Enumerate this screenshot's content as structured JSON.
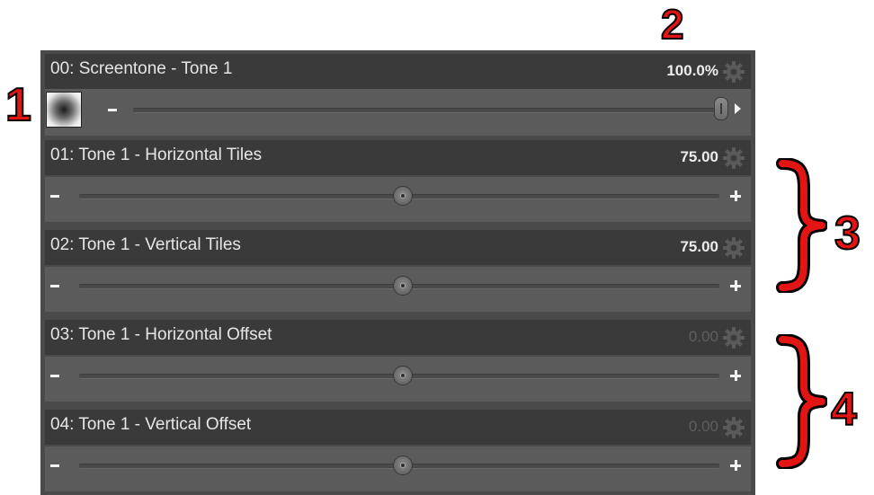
{
  "rows": [
    {
      "title": "00: Screentone - Tone 1",
      "value": "100.0%",
      "value_dim": false,
      "minus": "-",
      "plus": "",
      "slider_fraction": 1.0,
      "has_thumbnail": true
    },
    {
      "title": "01: Tone 1 - Horizontal Tiles",
      "value": "75.00",
      "value_dim": false,
      "minus": "-",
      "plus": "+",
      "slider_fraction": 0.5,
      "has_thumbnail": false
    },
    {
      "title": "02: Tone 1 - Vertical Tiles",
      "value": "75.00",
      "value_dim": false,
      "minus": "-",
      "plus": "+",
      "slider_fraction": 0.5,
      "has_thumbnail": false
    },
    {
      "title": "03: Tone 1 - Horizontal Offset",
      "value": "0.00",
      "value_dim": true,
      "minus": "-",
      "plus": "+",
      "slider_fraction": 0.5,
      "has_thumbnail": false
    },
    {
      "title": "04: Tone 1 - Vertical Offset",
      "value": "0.00",
      "value_dim": true,
      "minus": "-",
      "plus": "+",
      "slider_fraction": 0.5,
      "has_thumbnail": false
    }
  ],
  "callouts": {
    "c1": "1",
    "c2": "2",
    "c3": "3",
    "c4": "4"
  },
  "colors": {
    "callout": "#e31414",
    "panel": "#4a4a4a",
    "header": "#3a3a3a",
    "body": "#5b5b5b"
  },
  "icons": {
    "settings": "gear-icon",
    "thumbnail": "screentone-thumbnail"
  }
}
